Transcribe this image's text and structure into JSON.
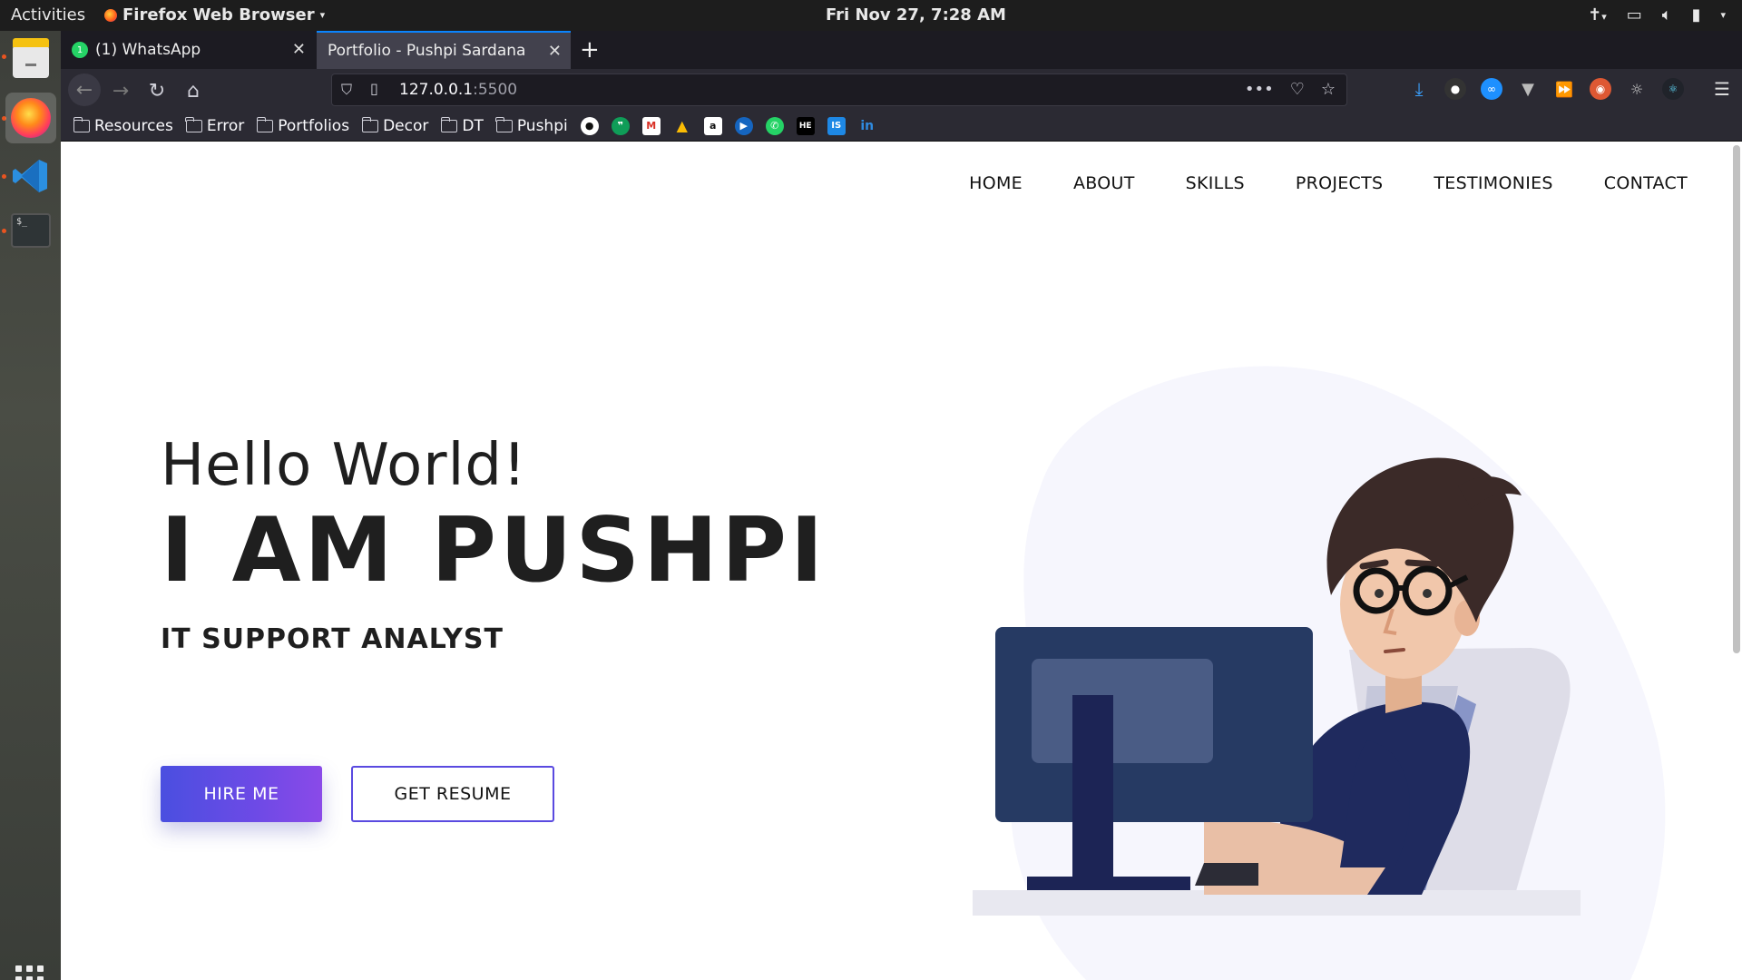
{
  "system": {
    "activities": "Activities",
    "app_menu": "Firefox Web Browser",
    "clock": "Fri Nov 27,  7:28 AM"
  },
  "browser": {
    "tabs": [
      {
        "label": "(1) WhatsApp",
        "icon": "whatsapp-icon",
        "badge": "1"
      },
      {
        "label": "Portfolio - Pushpi Sardana",
        "active": true
      }
    ],
    "url_host": "127.0.0.1",
    "url_port": ":5500",
    "bookmarks": [
      "Resources",
      "Error",
      "Portfolios",
      "Decor",
      "DT",
      "Pushpi"
    ],
    "bookmark_icons": [
      "github-icon",
      "hangouts-icon",
      "gmail-icon",
      "drive-icon",
      "amazon-icon",
      "play-icon",
      "whatsapp-icon",
      "hackerearth-icon",
      "is-icon",
      "linkedin-icon"
    ],
    "bookmark_favicon_text": {
      "amazon": "a",
      "hackerearth": "HE",
      "is": "IS",
      "linkedin": "in"
    },
    "accent": "#0a84ff"
  },
  "site": {
    "nav": [
      "HOME",
      "ABOUT",
      "SKILLS",
      "PROJECTS",
      "TESTIMONIES",
      "CONTACT"
    ],
    "hello": "Hello World!",
    "name": "I AM PUSHPI",
    "role": "IT SUPPORT ANALYST",
    "hire_button": "HIRE ME",
    "resume_button": "GET RESUME",
    "button_gradient": [
      "#4a4fe0",
      "#8a4ae8"
    ]
  }
}
